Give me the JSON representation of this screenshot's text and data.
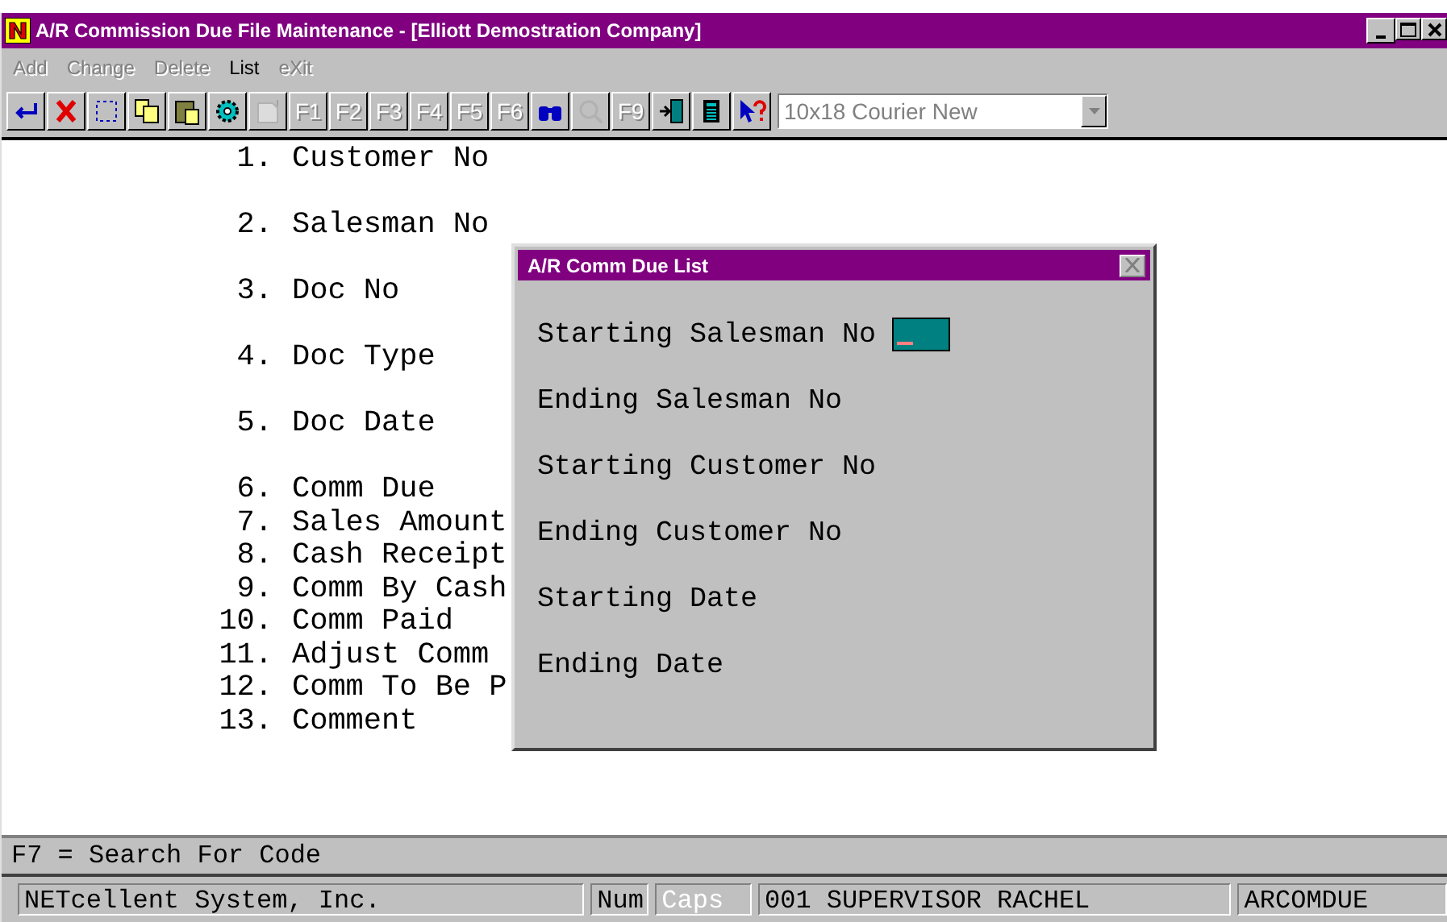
{
  "window": {
    "title": "A/R Commission Due File Maintenance - [Elliott Demostration Company]"
  },
  "menu": [
    {
      "label": "Add",
      "disabled": true
    },
    {
      "label": "Change",
      "disabled": true
    },
    {
      "label": "Delete",
      "disabled": true
    },
    {
      "label": "List",
      "disabled": false
    },
    {
      "label": "eXit",
      "disabled": true
    }
  ],
  "toolbar": [
    {
      "kind": "enter",
      "disabled": false
    },
    {
      "kind": "cancel",
      "disabled": false
    },
    {
      "kind": "select",
      "disabled": false
    },
    {
      "kind": "copy",
      "disabled": false
    },
    {
      "kind": "paste",
      "disabled": false
    },
    {
      "kind": "gear",
      "disabled": false
    },
    {
      "kind": "document",
      "disabled": true
    },
    {
      "kind": "key",
      "label": "F1",
      "disabled": true
    },
    {
      "kind": "key",
      "label": "F2",
      "disabled": true
    },
    {
      "kind": "key",
      "label": "F3",
      "disabled": true
    },
    {
      "kind": "key",
      "label": "F4",
      "disabled": true
    },
    {
      "kind": "key",
      "label": "F5",
      "disabled": true
    },
    {
      "kind": "key",
      "label": "F6",
      "disabled": true
    },
    {
      "kind": "binoculars",
      "disabled": false
    },
    {
      "kind": "magnifier",
      "disabled": true
    },
    {
      "kind": "key",
      "label": "F9",
      "disabled": true
    },
    {
      "kind": "exit",
      "disabled": false
    },
    {
      "kind": "calculator",
      "disabled": false
    },
    {
      "kind": "help",
      "disabled": false
    }
  ],
  "font_select": {
    "value": "10x18 Courier New"
  },
  "fields": [
    {
      "number": "1.",
      "label": "Customer No",
      "gap_after": true
    },
    {
      "number": "2.",
      "label": "Salesman No",
      "gap_after": true
    },
    {
      "number": "3.",
      "label": "Doc No",
      "gap_after": true
    },
    {
      "number": "4.",
      "label": "Doc Type",
      "gap_after": true
    },
    {
      "number": "5.",
      "label": "Doc Date",
      "gap_after": true
    },
    {
      "number": "6.",
      "label": "Comm Due",
      "gap_after": false
    },
    {
      "number": "7.",
      "label": "Sales Amount",
      "gap_after": false
    },
    {
      "number": "8.",
      "label": "Cash Receipt",
      "gap_after": false
    },
    {
      "number": "9.",
      "label": "Comm By Cash",
      "gap_after": false
    },
    {
      "number": "10.",
      "label": "Comm Paid",
      "gap_after": false
    },
    {
      "number": "11.",
      "label": "Adjust Comm",
      "gap_after": false
    },
    {
      "number": "12.",
      "label": "Comm To Be P",
      "gap_after": false
    },
    {
      "number": "13.",
      "label": "Comment",
      "gap_after": false
    }
  ],
  "dialog": {
    "title": "A/R Comm Due List",
    "rows": [
      {
        "label": "Starting Salesman No",
        "focused": true
      },
      {
        "label": "Ending Salesman No",
        "focused": false
      },
      {
        "label": "Starting Customer No",
        "focused": false
      },
      {
        "label": "Ending Customer No",
        "focused": false
      },
      {
        "label": "Starting Date",
        "focused": false
      },
      {
        "label": "Ending Date",
        "focused": false
      }
    ]
  },
  "hint": "F7 = Search For Code",
  "status_bar": [
    {
      "text": "NETcellent System, Inc.",
      "disabled": false
    },
    {
      "text": "Num",
      "disabled": false
    },
    {
      "text": "Caps",
      "disabled": true
    },
    {
      "text": "001 SUPERVISOR RACHEL",
      "disabled": false
    },
    {
      "text": "ARCOMDUE",
      "disabled": false
    }
  ]
}
